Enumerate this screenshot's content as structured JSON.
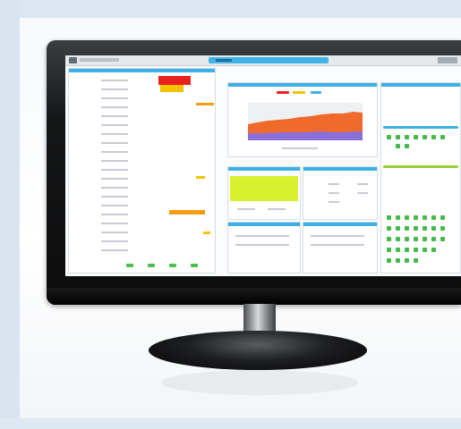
{
  "scene": {
    "description_label": "",
    "colors": {
      "accent": "#3bb0e5",
      "alert_red": "#e8221b",
      "warning_yellow": "#f5c200",
      "warning_orange": "#f59a13",
      "ok_green": "#45b94a",
      "highlight_lime": "#d8f02e",
      "chart_orange": "#f06a2c",
      "chart_purple": "#8b6fd8"
    }
  },
  "window": {
    "app_title": "",
    "title_bar_tab": ""
  },
  "icons": {
    "app": "app-logo-icon",
    "window_controls": "window-controls-icon"
  }
}
